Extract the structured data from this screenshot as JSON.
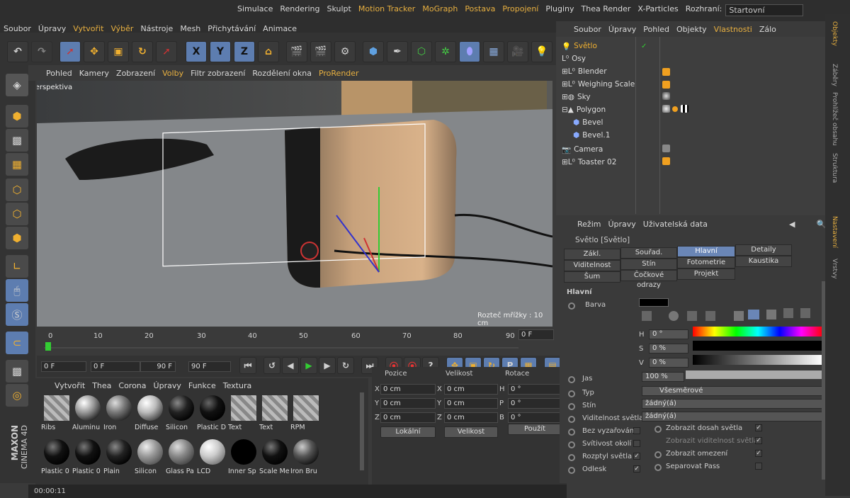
{
  "menubar": {
    "top": [
      "Simulace",
      "Rendering",
      "Skulpt",
      "Motion Tracker",
      "MoGraph",
      "Postava",
      "Propojení",
      "Pluginy",
      "Thea Render",
      "X-Particles",
      "Rozhraní:"
    ],
    "layout": "Startovní",
    "bottom": [
      "Soubor",
      "Úpravy",
      "Vytvořit",
      "Výběr",
      "Nástroje",
      "Mesh",
      "Přichytávání",
      "Animace"
    ]
  },
  "toolbar": {
    "x": "X",
    "y": "Y",
    "z": "Z"
  },
  "viewport": {
    "menu": [
      "Pohled",
      "Kamery",
      "Zobrazení",
      "Volby",
      "Filtr zobrazení",
      "Rozdělení okna",
      "ProRender"
    ],
    "label": "Perspektiva",
    "grid": "Rozteč mřížky : 10 cm"
  },
  "timeline": {
    "ticks": [
      "0",
      "10",
      "20",
      "30",
      "40",
      "50",
      "60",
      "70",
      "80",
      "90"
    ],
    "end": "0 F"
  },
  "transport": {
    "start": "0 F",
    "slider_left": "0 F",
    "slider_right": "90 F",
    "end": "90 F"
  },
  "materials": {
    "menu": [
      "Vytvořit",
      "Thea",
      "Corona",
      "Úpravy",
      "Funkce",
      "Textura"
    ],
    "row1": [
      "Ribs",
      "Aluminu",
      "Iron",
      "Diffuse",
      "Silicon",
      "Plastic D",
      "Text",
      "Text",
      "RPM"
    ],
    "row2": [
      "Plastic 0",
      "Plastic 0",
      "Plain",
      "Silicon",
      "Glass Pa",
      "LCD",
      "Inner Sp",
      "Scale Me",
      "Iron Bru"
    ],
    "brand1": "MAXON",
    "brand2": "CINEMA 4D"
  },
  "coords": {
    "headers": [
      "Pozice",
      "Velikost",
      "Rotace"
    ],
    "rows": [
      [
        "X",
        "0 cm",
        "X",
        "0 cm",
        "H",
        "0 °"
      ],
      [
        "Y",
        "0 cm",
        "Y",
        "0 cm",
        "P",
        "0 °"
      ],
      [
        "Z",
        "0 cm",
        "Z",
        "0 cm",
        "B",
        "0 °"
      ]
    ],
    "mode": "Lokální",
    "size": "Velikost",
    "apply": "Použít"
  },
  "objects": {
    "menu": [
      "Soubor",
      "Úpravy",
      "Pohled",
      "Objekty",
      "Vlastnosti",
      "Zálo"
    ],
    "items": [
      "Světlo",
      "Osy",
      "Blender",
      "Weighing Scale",
      "Sky",
      "Polygon",
      "Bevel",
      "Bevel.1",
      "Camera",
      "Toaster 02"
    ]
  },
  "attributes": {
    "menu": [
      "Režim",
      "Úpravy",
      "Uživatelská data"
    ],
    "title": "Světlo [Světlo]",
    "tabs": [
      "Zákl.",
      "Souřad.",
      "Hlavní",
      "Detaily",
      "Viditelnost",
      "Stín",
      "Fotometrie",
      "Kaustika",
      "Šum",
      "Čočkové odrazy",
      "Projekt"
    ],
    "section": "Hlavní",
    "color": "Barva",
    "h_label": "H",
    "h_val": "0 °",
    "s_label": "S",
    "s_val": "0 %",
    "v_label": "V",
    "v_val": "0 %",
    "swatch": "#000000",
    "brightness_label": "Jas",
    "brightness_val": "100 %",
    "type_label": "Typ",
    "type_val": "Všesměrové",
    "shadow_label": "Stín",
    "shadow_val": "žádný(á)",
    "visible_label": "Viditelnost světla",
    "visible_val": "žádný(á)",
    "checks_left": [
      "Bez vyzařování",
      "Svítivost okolí",
      "Rozptyl světla",
      "Odlesk"
    ],
    "checks_right": [
      "Zobrazit dosah světla",
      "Zobrazit viditelnost světla",
      "Zobrazit omezení",
      "Separovat Pass"
    ]
  },
  "sidetabs": [
    "Objekty",
    "Záběry",
    "Prohlížeč obsahu",
    "Struktura",
    "Nastavení",
    "Vrstvy"
  ],
  "status": "00:00:11"
}
